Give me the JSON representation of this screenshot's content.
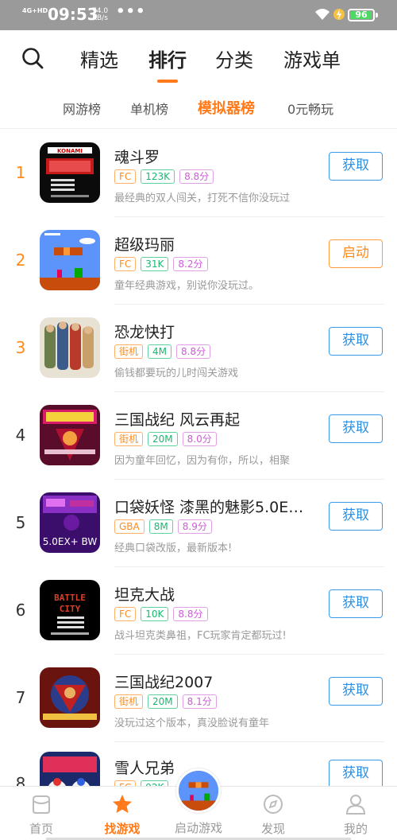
{
  "status_bar": {
    "network": "4G+HD",
    "time": "09:53",
    "speed_value": "74.0",
    "speed_unit": "KB/s",
    "more": "•••",
    "battery": "96",
    "battery_level": 0.96
  },
  "top_nav": {
    "tabs": [
      "精选",
      "排行",
      "分类",
      "游戏单"
    ],
    "active_tab": "排行",
    "accent_color": "#ff7a1a"
  },
  "sub_nav": {
    "tabs": [
      "网游榜",
      "单机榜",
      "模拟器榜",
      "0元畅玩"
    ],
    "active_tab": "模拟器榜"
  },
  "games": [
    {
      "rank": "1",
      "title": "魂斗罗",
      "platform": "FC",
      "size": "123K",
      "score": "8.8分",
      "desc": "最经典的双人闯关，打死不信你没玩过",
      "button": "获取",
      "icon": "contra-icon"
    },
    {
      "rank": "2",
      "title": "超级玛丽",
      "platform": "FC",
      "size": "31K",
      "score": "8.2分",
      "desc": "童年经典游戏，别说你没玩过。",
      "button": "启动",
      "icon": "super-mario-icon"
    },
    {
      "rank": "3",
      "title": "恐龙快打",
      "platform": "街机",
      "size": "4M",
      "score": "8.8分",
      "desc": "偷钱都要玩的儿时闯关游戏",
      "button": "获取",
      "icon": "cadillacs-dinosaurs-icon"
    },
    {
      "rank": "4",
      "title": "三国战纪 风云再起",
      "platform": "街机",
      "size": "20M",
      "score": "8.0分",
      "desc": "因为童年回忆，因为有你，所以，相聚",
      "button": "获取",
      "icon": "sanguo-zhanji-icon"
    },
    {
      "rank": "5",
      "title": "口袋妖怪 漆黑的魅影5.0E…",
      "platform": "GBA",
      "size": "8M",
      "score": "8.9分",
      "desc": "经典口袋改版，最新版本!",
      "button": "获取",
      "icon": "pokemon-dark-phantom-icon",
      "icon_text": "5.0EX+ BW"
    },
    {
      "rank": "6",
      "title": "坦克大战",
      "platform": "FC",
      "size": "10K",
      "score": "8.8分",
      "desc": "战斗坦克类鼻祖，FC玩家肯定都玩过!",
      "button": "获取",
      "icon": "battle-city-icon",
      "icon_text": "BATTLE CITY"
    },
    {
      "rank": "7",
      "title": "三国战纪2007",
      "platform": "街机",
      "size": "20M",
      "score": "8.1分",
      "desc": "没玩过这个版本，真没脸说有童年",
      "button": "获取",
      "icon": "sanguo-2007-icon"
    },
    {
      "rank": "8",
      "title": "雪人兄弟",
      "platform": "FC",
      "size": "92K",
      "score": "",
      "desc": "",
      "button": "获取",
      "icon": "snow-bros-icon"
    }
  ],
  "bottom_bar": {
    "items": [
      {
        "label": "首页",
        "icon": "home-icon"
      },
      {
        "label": "找游戏",
        "icon": "star-icon"
      },
      {
        "label": "启动游戏",
        "icon": "launch-game-icon"
      },
      {
        "label": "发现",
        "icon": "compass-icon"
      },
      {
        "label": "我的",
        "icon": "profile-icon"
      }
    ],
    "active": "找游戏"
  }
}
